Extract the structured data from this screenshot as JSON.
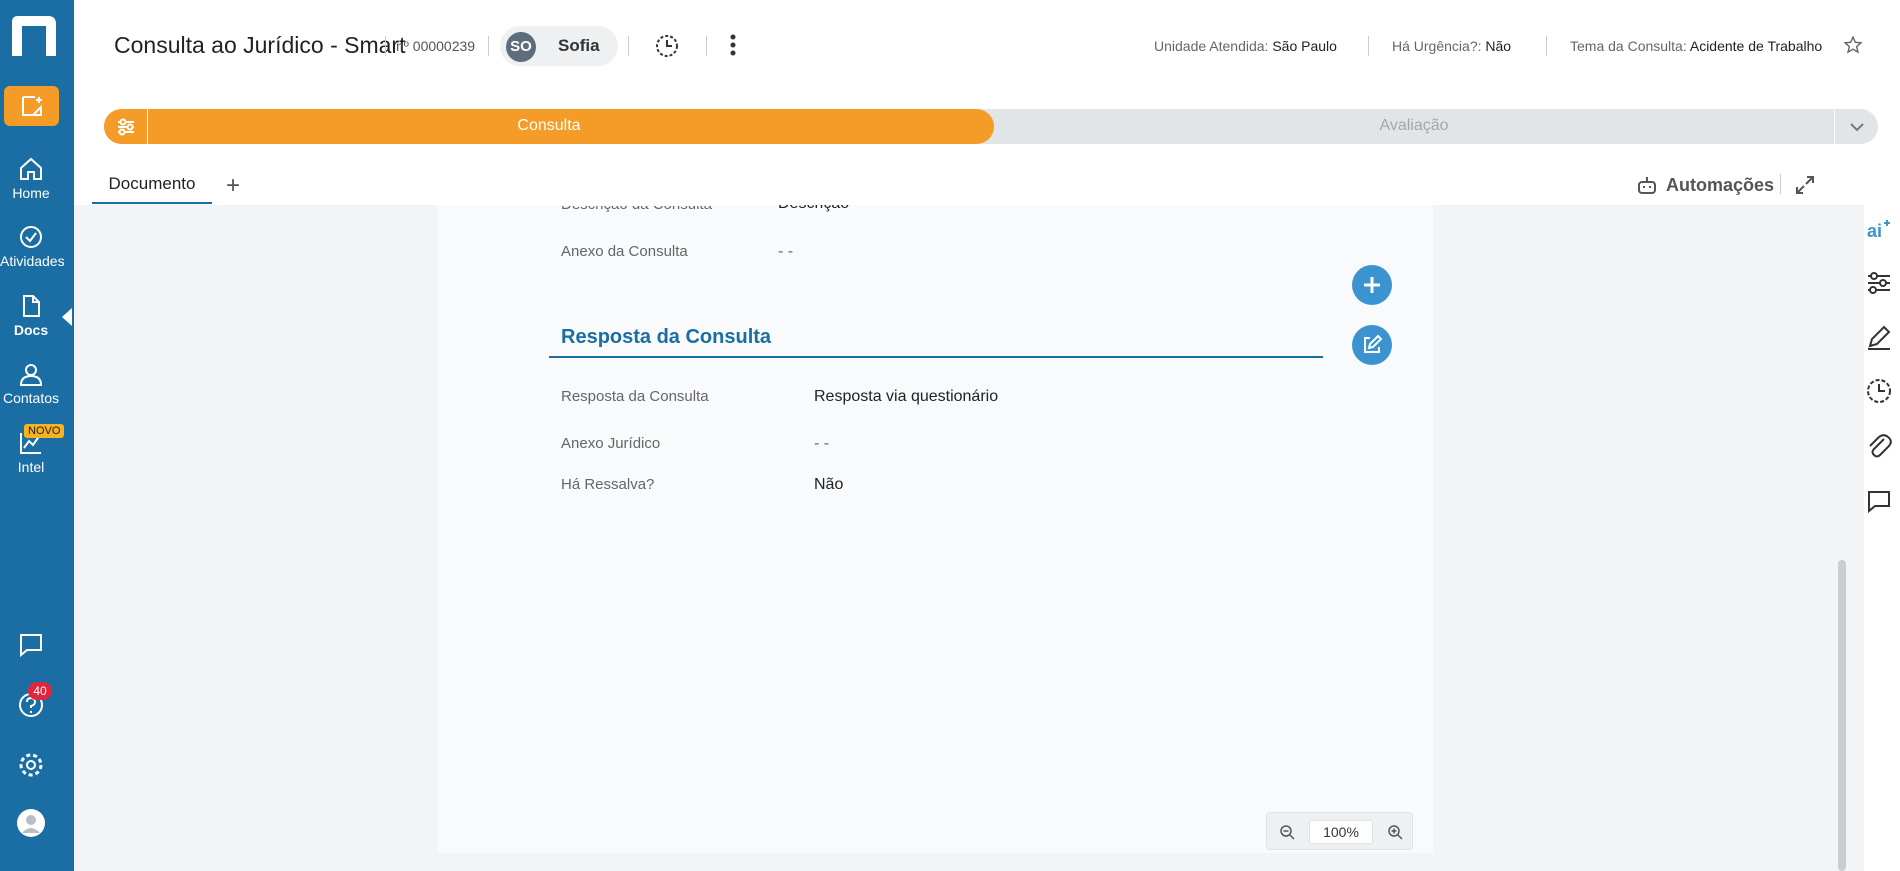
{
  "sidebar": {
    "items": [
      {
        "label": "Home",
        "icon": "home-icon"
      },
      {
        "label": "Atividades",
        "icon": "check-circle-icon"
      },
      {
        "label": "Docs",
        "icon": "document-icon"
      },
      {
        "label": "Contatos",
        "icon": "person-icon"
      },
      {
        "label": "Intel",
        "icon": "chart-icon"
      }
    ],
    "novo_badge": "NOVO",
    "help_count": "40"
  },
  "header": {
    "title": "Consulta ao Jurídico - Smart",
    "record_number": "nº 00000239",
    "owner_initials": "SO",
    "owner_name": "Sofia",
    "meta": [
      {
        "label": "Unidade Atendida:",
        "value": "São Paulo"
      },
      {
        "label": "Há Urgência?:",
        "value": "Não"
      },
      {
        "label": "Tema da Consulta:",
        "value": "Acidente de Trabalho"
      }
    ]
  },
  "stages": {
    "active": "Consulta",
    "next": "Avaliação"
  },
  "tabs": {
    "document": "Documento",
    "add": "+",
    "automations": "Automações"
  },
  "document": {
    "top_fields": [
      {
        "label": "Descrição da Consulta",
        "value": "Descrição"
      },
      {
        "label": "Anexo da Consulta",
        "value": "- -"
      }
    ],
    "section_title": "Resposta da Consulta",
    "section_fields": [
      {
        "label": "Resposta da Consulta",
        "value": "Resposta via questionário"
      },
      {
        "label": "Anexo Jurídico",
        "value": "- -"
      },
      {
        "label": "Há Ressalva?",
        "value": "Não"
      }
    ]
  },
  "zoom": {
    "value": "100%"
  },
  "colors": {
    "sidebar": "#1a6ea3",
    "accent": "#f49b28",
    "section": "#1a6ea3",
    "fab": "#3b93d0"
  }
}
